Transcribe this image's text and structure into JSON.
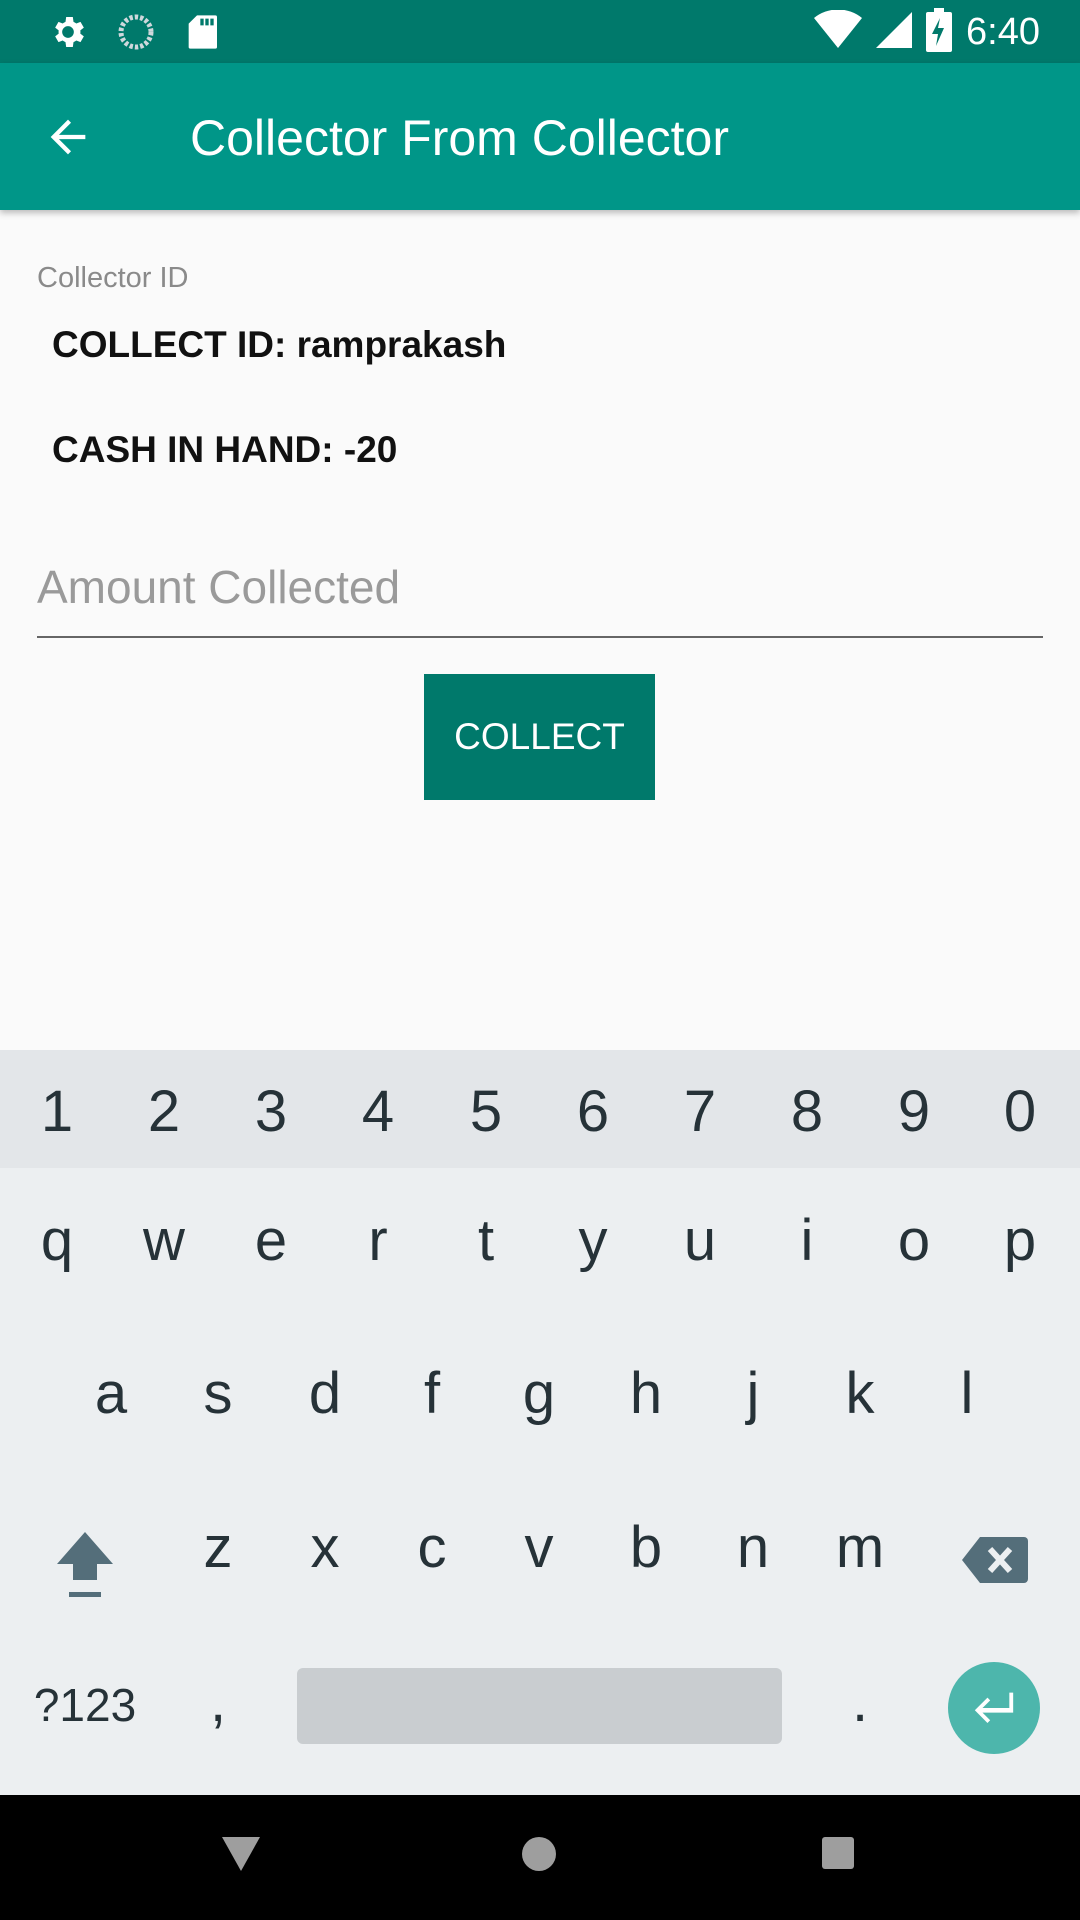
{
  "status_bar": {
    "time": "6:40",
    "icons": [
      "gear-icon",
      "sync-icon",
      "sd-card-icon",
      "wifi-icon",
      "signal-icon",
      "battery-charging-icon"
    ]
  },
  "app_bar": {
    "title": "Collector From Collector",
    "back_icon": "arrow-back-icon"
  },
  "form": {
    "section_label": "Collector ID",
    "collect_id_text": "COLLECT ID: ramprakash",
    "cash_in_hand_text": "CASH IN HAND: -20",
    "amount_placeholder": "Amount Collected",
    "amount_value": "",
    "collect_button": "COLLECT"
  },
  "keyboard": {
    "number_row": [
      "1",
      "2",
      "3",
      "4",
      "5",
      "6",
      "7",
      "8",
      "9",
      "0"
    ],
    "row1": [
      "q",
      "w",
      "e",
      "r",
      "t",
      "y",
      "u",
      "i",
      "o",
      "p"
    ],
    "row2": [
      "a",
      "s",
      "d",
      "f",
      "g",
      "h",
      "j",
      "k",
      "l"
    ],
    "row3": [
      "z",
      "x",
      "c",
      "v",
      "b",
      "n",
      "m"
    ],
    "symbols_key": "?123",
    "comma_key": ",",
    "period_key": ".",
    "shift_icon": "shift-icon",
    "backspace_icon": "backspace-icon",
    "enter_icon": "enter-icon",
    "enter_color": "#4db6ac"
  },
  "nav_bar": {
    "back_icon": "nav-back-icon",
    "home_icon": "nav-home-icon",
    "recents_icon": "nav-recents-icon"
  }
}
